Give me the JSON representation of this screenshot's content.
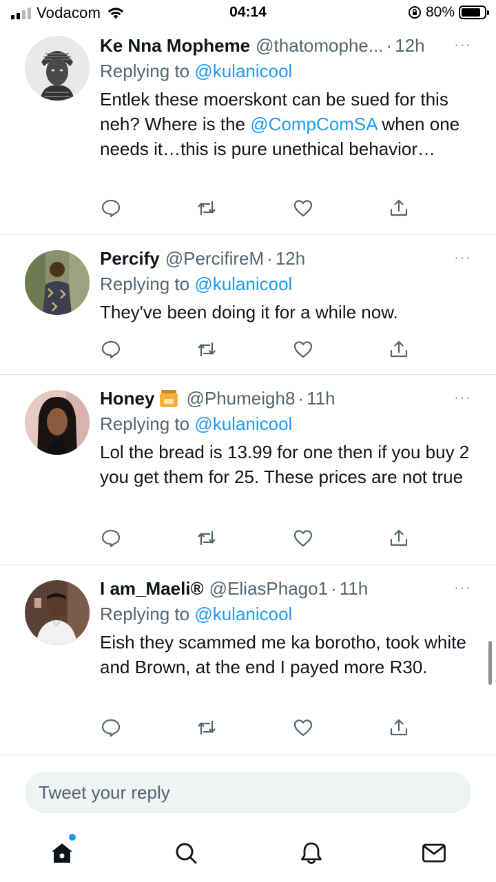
{
  "status_bar": {
    "carrier": "Vodacom",
    "time": "04:14",
    "battery_percent": "80%",
    "battery_level": 0.8,
    "signal_bars": 2,
    "icons": [
      "signal-icon",
      "wifi-icon",
      "orientation-lock-icon",
      "battery-icon"
    ]
  },
  "tweets": [
    {
      "name": "Ke Nna Mopheme",
      "handle": "@thatomophe...",
      "sep": "·",
      "time": "12h",
      "more": "···",
      "replying_label": "Replying to",
      "replying_to": "@kulanicool",
      "text_parts": [
        "Entlek these moerskont can be sued for this neh? Where is the ",
        "@CompComSA",
        " when one needs it…this is pure unethical behavior…"
      ]
    },
    {
      "name": "Percify",
      "handle": "@PercifireM",
      "sep": "·",
      "time": "12h",
      "more": "···",
      "replying_label": "Replying to",
      "replying_to": "@kulanicool",
      "text": "They've been doing it for a while now."
    },
    {
      "name": "Honey",
      "name_emoji": "honey-pot-icon",
      "handle": "@Phumeigh8",
      "sep": "·",
      "time": "11h",
      "more": "···",
      "replying_label": "Replying to",
      "replying_to": "@kulanicool",
      "text": "Lol the bread is 13.99 for one then if you buy 2 you get them for 25. These prices are not true"
    },
    {
      "name": "I am_Maeli®",
      "handle": "@EliasPhago1",
      "sep": "·",
      "time": "11h",
      "more": "···",
      "replying_label": "Replying to",
      "replying_to": "@kulanicool",
      "text": "Eish they scammed me ka borotho, took white and Brown, at the end I payed more R30."
    }
  ],
  "tweet_actions": [
    "reply-icon",
    "retweet-icon",
    "like-icon",
    "share-icon"
  ],
  "reply_box": {
    "placeholder": "Tweet your reply"
  },
  "bottom_nav": {
    "items": [
      "home-icon",
      "search-icon",
      "notifications-icon",
      "messages-icon"
    ],
    "active": "home-icon",
    "colors": {
      "accent": "#1d9bf0",
      "icon": "#0f1419"
    }
  }
}
